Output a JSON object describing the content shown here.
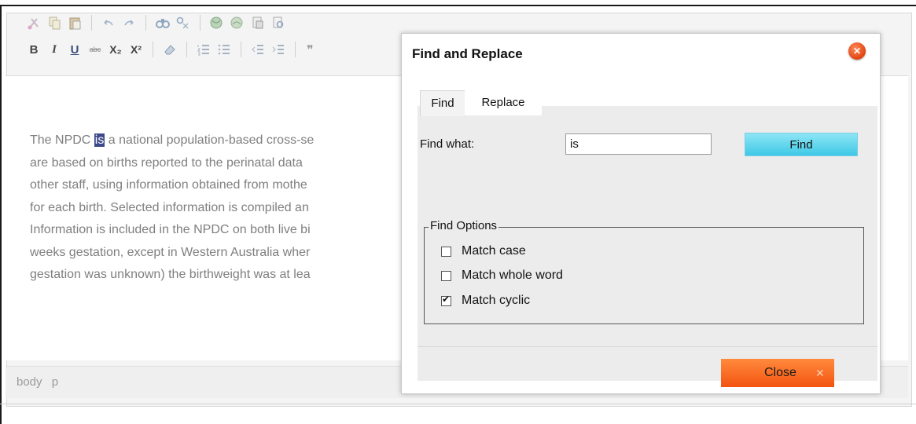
{
  "document": {
    "highlight": "is",
    "lines": [
      [
        "The NPDC ",
        "is",
        " a national population-based cross-se"
      ],
      [
        "are based on births reported to the perinatal data"
      ],
      [
        "other staff, using information obtained from mothe"
      ],
      [
        "for each birth. Selected information is compiled an"
      ],
      [
        "Information is included in the NPDC on both live bi"
      ],
      [
        "weeks gestation, except in Western Australia wher"
      ],
      [
        "gestation was unknown) the birthweight was at lea"
      ]
    ]
  },
  "statusbar": {
    "path": [
      "body",
      "p"
    ]
  },
  "toolbar": {
    "row1": [
      "cut-icon",
      "copy-icon",
      "paste-icon",
      "undo-icon",
      "redo-icon",
      "find-icon",
      "replace-icon",
      "web-icon",
      "web2-icon",
      "page-icon",
      "preview-icon"
    ],
    "row2_text": {
      "bold": "B",
      "italic": "I",
      "underline": "U",
      "strike": "abc",
      "sub": "X₂",
      "sup": "X²"
    }
  },
  "dialog": {
    "title": "Find and Replace",
    "tabs": [
      "Find",
      "Replace"
    ],
    "find_label": "Find what:",
    "find_value": "is",
    "find_button": "Find",
    "options_legend": "Find Options",
    "options": [
      {
        "label": "Match case",
        "checked": false
      },
      {
        "label": "Match whole word",
        "checked": false
      },
      {
        "label": "Match cyclic",
        "checked": true
      }
    ],
    "close_button": "Close",
    "close_x": "✕"
  },
  "colors": {
    "accent_find": "#3ec8e6",
    "accent_close": "#f35410"
  }
}
